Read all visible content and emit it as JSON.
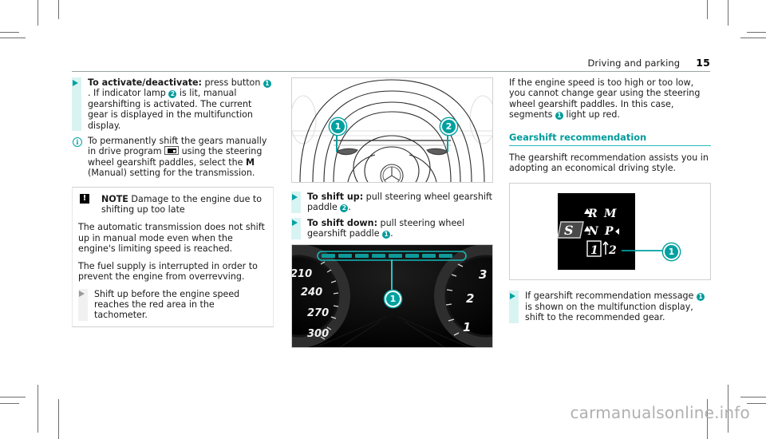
{
  "header": {
    "chapter": "Driving and parking",
    "page_number": "15"
  },
  "colors": {
    "accent_teal": "#009b9b",
    "bullet_highlight": "#d8f4f2",
    "marker_teal": "#00a0a0",
    "note_icon": "#000000"
  },
  "column_left": {
    "action_activate": {
      "bold_lead": "To activate/deactivate:",
      "text_a": " press button ",
      "badge_1": "1",
      "text_b": ". If indicator lamp ",
      "badge_2": "2",
      "text_c": " is lit, manual gearshifting is activated. The current gear is displayed in the multifunction display."
    },
    "info_manual_shift": {
      "text_a": "To permanently shift the gears manually in drive program ",
      "icon": "drive-program-icon",
      "text_b": " using the steering wheel gearshift paddles, select the ",
      "bold_m": "M",
      "text_c": " (Manual) setting for the transmission."
    },
    "note": {
      "icon_label": "!",
      "title": "NOTE",
      "title_text": " Damage to the engine due to shifting up too late",
      "paragraph_1": "The automatic transmission does not shift up in manual mode even when the engine's limiting speed is reached.",
      "paragraph_2": "The fuel supply is interrupted in order to prevent the engine from overrevving.",
      "action": "Shift up before the engine speed reaches the red area in the tachometer."
    }
  },
  "column_middle": {
    "figure_steering_wheel": {
      "name": "steering-wheel-gearshift-paddles",
      "marker_1": "1",
      "marker_2": "2"
    },
    "action_shift_up": {
      "bold_lead": "To shift up:",
      "text_a": " pull steering wheel gearshift paddle ",
      "badge": "2",
      "text_b": "."
    },
    "action_shift_down": {
      "bold_lead": "To shift down:",
      "text_a": " pull steering wheel gearshift paddle ",
      "badge": "1",
      "text_b": "."
    },
    "figure_cluster": {
      "name": "instrument-cluster-gearshift-segments",
      "marker_1": "1",
      "speedometer_labels": [
        "210",
        "240",
        "270",
        "300"
      ],
      "tachometer_labels": [
        "3",
        "2",
        "1"
      ]
    }
  },
  "column_right": {
    "paragraph_engine_speed": {
      "text_a": "If the engine speed is too high or too low, you cannot change gear using the steering wheel gearshift paddles. In this case, segments ",
      "badge": "1",
      "text_b": " light up red."
    },
    "section_heading": "Gearshift recommendation",
    "paragraph_intro": "The gearshift recommendation assists you in adopting an economical driving style.",
    "figure_gear_display": {
      "name": "multifunction-display-gearshift-recommendation",
      "marker_1": "1",
      "selector_s": "S",
      "row_top": "R M",
      "row_mid": "N P",
      "current_gear": "1",
      "recommended_gear": "2",
      "recommend_arrow": "↑"
    },
    "action_recommendation": {
      "text_a": "If gearshift recommendation message ",
      "badge": "1",
      "text_b": " is shown on the multifunction display, shift to the recommended gear."
    }
  },
  "watermark": {
    "text": "carmanualsonline.info"
  }
}
